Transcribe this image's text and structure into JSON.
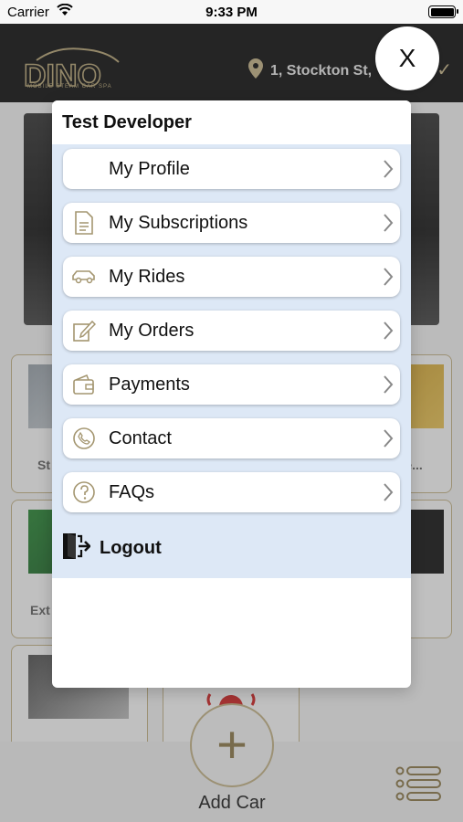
{
  "status_bar": {
    "carrier": "Carrier",
    "time": "9:33 PM"
  },
  "header": {
    "logo_text": "DINO",
    "logo_subtitle": "MOBILE STEAM CAR SPA",
    "location": "1, Stockton St,"
  },
  "background_tiles": [
    {
      "label": "St"
    },
    {
      "label": "rle..."
    },
    {
      "label": "Ext"
    }
  ],
  "bottom_bar": {
    "add_car_label": "Add Car"
  },
  "drawer": {
    "user_name": "Test Developer",
    "items": [
      {
        "label": "My Profile",
        "icon": "blank-icon"
      },
      {
        "label": "My Subscriptions",
        "icon": "document-icon"
      },
      {
        "label": "My Rides",
        "icon": "car-icon"
      },
      {
        "label": "My Orders",
        "icon": "edit-icon"
      },
      {
        "label": "Payments",
        "icon": "wallet-icon"
      },
      {
        "label": "Contact",
        "icon": "phone-icon"
      },
      {
        "label": "FAQs",
        "icon": "help-icon"
      }
    ],
    "logout_label": "Logout"
  },
  "close_button": {
    "label": "X"
  },
  "colors": {
    "accent_gold": "#c4b48a",
    "menu_background": "#dde8f6",
    "header_bg": "#161616"
  }
}
